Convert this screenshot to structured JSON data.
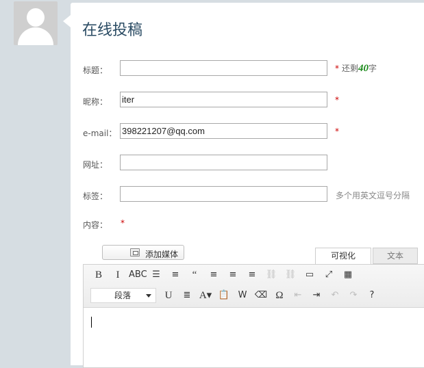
{
  "page": {
    "title": "在线投稿"
  },
  "form": {
    "title_label": "标题：",
    "title_value": "",
    "remaining_prefix": "还剩",
    "remaining_count": "40",
    "remaining_suffix": "字",
    "required_mark": "*",
    "nickname_label": "昵称：",
    "nickname_value": "iter",
    "email_label": "e-mail：",
    "email_value": "398221207@qq.com",
    "url_label": "网址：",
    "url_value": "",
    "tags_label": "标签：",
    "tags_value": "",
    "tags_hint": "多个用英文逗号分隔",
    "content_label": "内容："
  },
  "editor": {
    "add_media_label": "添加媒体",
    "tab_visual": "可视化",
    "tab_text": "文本",
    "format_select": "段落",
    "toolbar_row1": [
      {
        "name": "bold-button",
        "glyph": "B",
        "serif": true,
        "dim": false
      },
      {
        "name": "italic-button",
        "glyph": "I",
        "serif": true,
        "dim": false
      },
      {
        "name": "strikethrough-button",
        "glyph": "ABC",
        "serif": false,
        "dim": false
      },
      {
        "name": "bullet-list-button",
        "glyph": "☰",
        "serif": false,
        "dim": false
      },
      {
        "name": "numbered-list-button",
        "glyph": "≡",
        "serif": false,
        "dim": false
      },
      {
        "name": "blockquote-button",
        "glyph": "“",
        "serif": true,
        "dim": false
      },
      {
        "name": "align-left-button",
        "glyph": "≡",
        "serif": false,
        "dim": false
      },
      {
        "name": "align-center-button",
        "glyph": "≡",
        "serif": false,
        "dim": false
      },
      {
        "name": "align-right-button",
        "glyph": "≡",
        "serif": false,
        "dim": false
      },
      {
        "name": "insert-link-button",
        "glyph": "⛓",
        "serif": false,
        "dim": true
      },
      {
        "name": "remove-link-button",
        "glyph": "⛓",
        "serif": false,
        "dim": true
      },
      {
        "name": "read-more-button",
        "glyph": "▭",
        "serif": false,
        "dim": false
      },
      {
        "name": "fullscreen-button",
        "glyph": "⤢",
        "serif": false,
        "dim": false
      },
      {
        "name": "kitchen-sink-button",
        "glyph": "▦",
        "serif": false,
        "dim": false
      }
    ],
    "toolbar_row2": [
      {
        "name": "underline-button",
        "glyph": "U",
        "serif": true,
        "dim": false
      },
      {
        "name": "justify-button",
        "glyph": "≣",
        "serif": false,
        "dim": false
      },
      {
        "name": "text-color-button",
        "glyph": "A▾",
        "serif": true,
        "dim": false
      },
      {
        "name": "paste-text-button",
        "glyph": "📋",
        "serif": false,
        "dim": false
      },
      {
        "name": "paste-word-button",
        "glyph": "W",
        "serif": false,
        "dim": false
      },
      {
        "name": "clear-format-button",
        "glyph": "⌫",
        "serif": false,
        "dim": false
      },
      {
        "name": "special-char-button",
        "glyph": "Ω",
        "serif": true,
        "dim": false
      },
      {
        "name": "outdent-button",
        "glyph": "⇤",
        "serif": false,
        "dim": true
      },
      {
        "name": "indent-button",
        "glyph": "⇥",
        "serif": false,
        "dim": false
      },
      {
        "name": "undo-button",
        "glyph": "↶",
        "serif": false,
        "dim": true
      },
      {
        "name": "redo-button",
        "glyph": "↷",
        "serif": false,
        "dim": true
      },
      {
        "name": "help-button",
        "glyph": "?",
        "serif": false,
        "dim": false
      }
    ]
  },
  "colors": {
    "required": "#cc0000",
    "count": "#1a8a1a",
    "title": "#2a4b63"
  }
}
